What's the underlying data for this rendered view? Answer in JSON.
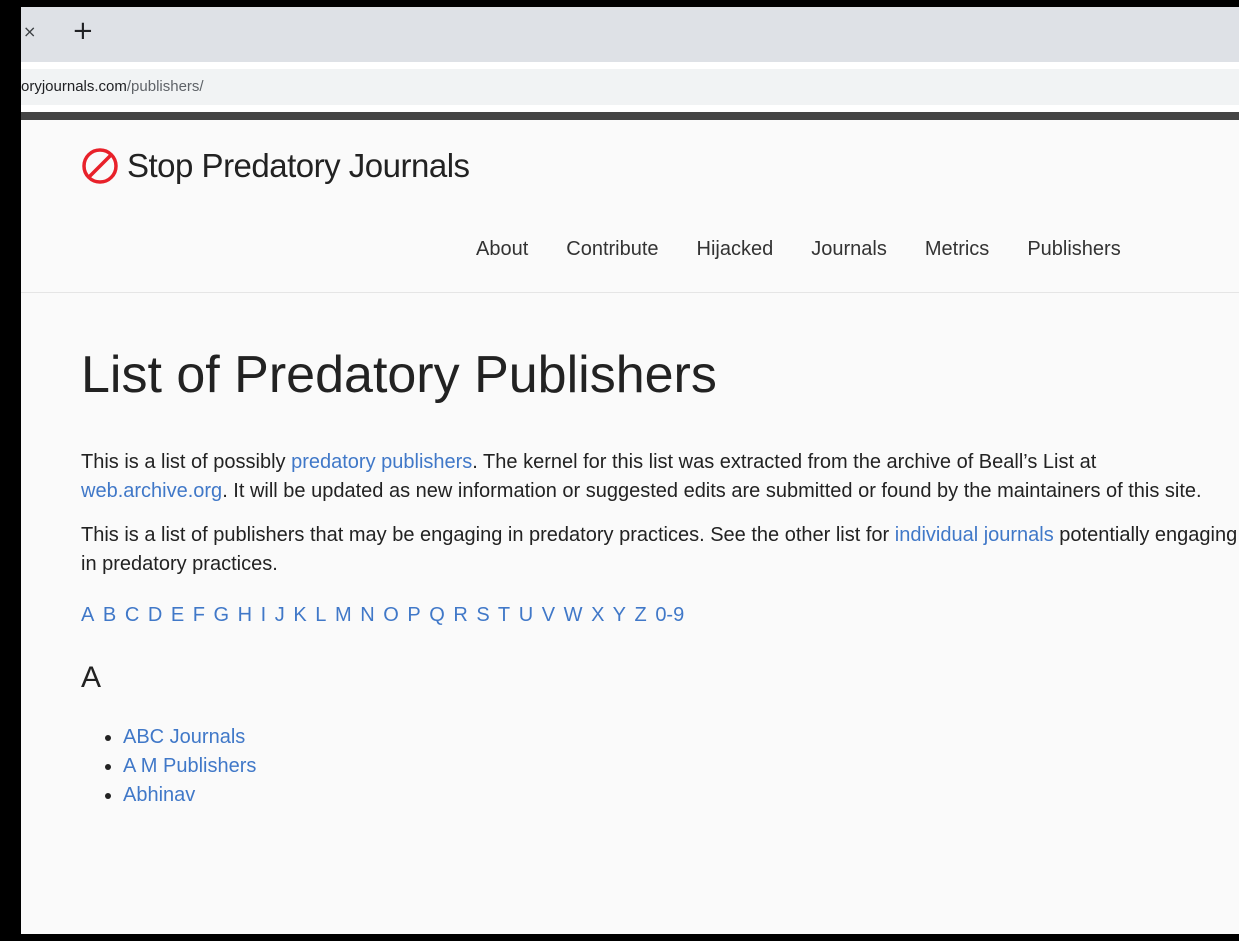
{
  "browser": {
    "tab_close": "×",
    "new_tab": "+",
    "url_domain": "oryjournals.com",
    "url_path": "/publishers/"
  },
  "site": {
    "title": "Stop Predatory Journals",
    "logo_icon": "prohibited-circle-icon",
    "logo_color": "#e8212a",
    "nav": [
      "About",
      "Contribute",
      "Hijacked",
      "Journals",
      "Metrics",
      "Publishers"
    ]
  },
  "page": {
    "heading": "List of Predatory Publishers",
    "p1": {
      "t1": "This is a list of possibly ",
      "link1": "predatory publishers",
      "t2": ". The kernel for this list was extracted from the archive of Beall’s List at ",
      "link2": "web.archive.org",
      "t3": ". It will be updated as new information or suggested edits are submitted or found by the maintainers of this site."
    },
    "p2": {
      "t1": "This is a list of publishers that may be engaging in predatory practices. See the other list for ",
      "link1": "individual journals",
      "t2": " potentially engaging in predatory practices."
    },
    "letters": [
      "A",
      "B",
      "C",
      "D",
      "E",
      "F",
      "G",
      "H",
      "I",
      "J",
      "K",
      "L",
      "M",
      "N",
      "O",
      "P",
      "Q",
      "R",
      "S",
      "T",
      "U",
      "V",
      "W",
      "X",
      "Y",
      "Z",
      "0-9"
    ],
    "section_heading": "A",
    "publishers": [
      "ABC Journals",
      "A M Publishers",
      "Abhinav"
    ],
    "link_color": "#4078c8"
  }
}
